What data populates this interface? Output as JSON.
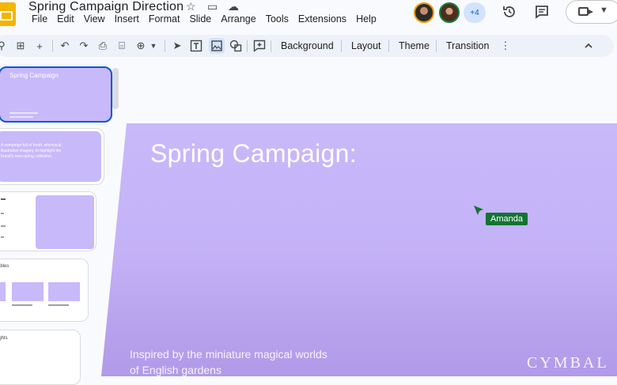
{
  "document": {
    "title": "Spring Campaign Direction"
  },
  "menu": [
    "File",
    "Edit",
    "View",
    "Insert",
    "Format",
    "Slide",
    "Arrange",
    "Tools",
    "Extensions",
    "Help"
  ],
  "collaborators": {
    "more_count": "+4"
  },
  "toolbar": {
    "background_label": "Background",
    "layout_label": "Layout",
    "theme_label": "Theme",
    "transition_label": "Transition"
  },
  "filmstrip": {
    "slide1": {
      "title": "Spring Campaign"
    },
    "slide2": {
      "body": "A campaign full of fresh, whimsical, illustrative imagery, to highlight the brand's new spring collection."
    },
    "slide4": {
      "title": "ables"
    },
    "slide5": {
      "title": "ights"
    }
  },
  "slide": {
    "title": "Spring Campaign:",
    "subtitle": "Inspired by the miniature magical worlds of English gardens",
    "logo": "CYMBAL"
  },
  "cursor": {
    "name": "Amanda"
  },
  "colors": {
    "slide_bg": "#c4b2f7",
    "accent": "#0b57d0",
    "cursor_tag": "#137333",
    "app_logo": "#f4b400"
  }
}
